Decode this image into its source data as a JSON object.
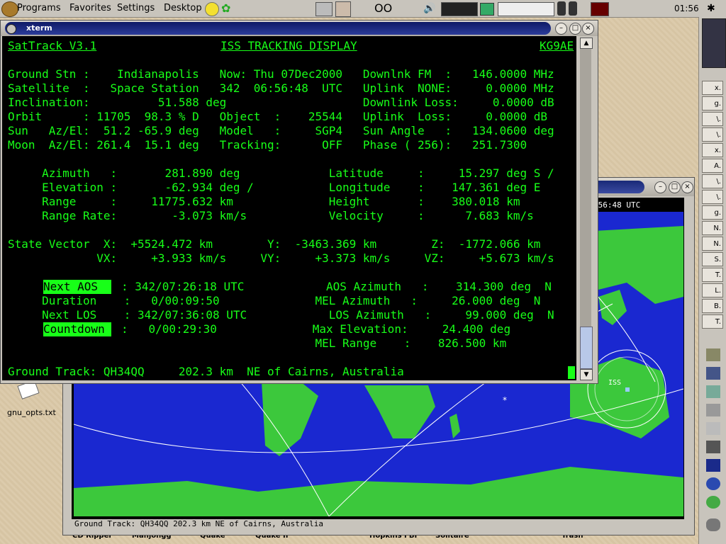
{
  "panel": {
    "programs": "Programs",
    "favorites": "Favorites",
    "settings": "Settings",
    "desktop": "Desktop",
    "clock": "01:56"
  },
  "xterm": {
    "title": "xterm",
    "header_left": "SatTrack V3.1",
    "header_center": "ISS TRACKING DISPLAY",
    "header_right": "KG9AE",
    "lines": {
      "r1": "Ground Stn :    Indianapolis   Now: Thu 07Dec2000   Downlnk FM  :   146.0000 MHz",
      "r2": "Satellite  :   Space Station   342  06:56:48  UTC   Uplink  NONE:     0.0000 MHz",
      "r3": "Inclination:          51.588 deg                    Downlink Loss:     0.0000 dB",
      "r4": "Orbit      : 11705  98.3 % D   Object  :    25544   Uplink  Loss:     0.0000 dB",
      "r5": "Sun   Az/El:  51.2 -65.9 deg   Model   :     SGP4   Sun Angle   :   134.0600 deg",
      "r6": "Moon  Az/El: 261.4  15.1 deg   Tracking:      OFF   Phase ( 256):   251.7300",
      "r7": "     Azimuth   :       281.890 deg             Latitude     :     15.297 deg S /",
      "r8": "     Elevation :       -62.934 deg /           Longitude    :    147.361 deg E",
      "r9": "     Range     :     11775.632 km              Height       :    380.018 km",
      "r10": "     Range Rate:        -3.073 km/s            Velocity     :      7.683 km/s",
      "r11": "State Vector  X:  +5524.472 km        Y:  -3463.369 km        Z:  -1772.066 km",
      "r12": "             VX:     +3.933 km/s     VY:     +3.373 km/s     VZ:     +5.673 km/s",
      "r13a": "Next AOS  ",
      "r13b": ": 342/07:26:18 UTC            AOS Azimuth   :    314.300 deg  N",
      "r14": "     Duration    :   0/00:09:50              MEL Azimuth   :     26.000 deg  N",
      "r15": "     Next LOS    : 342/07:36:08 UTC            LOS Azimuth   :     99.000 deg  N",
      "r16a": "Countdown ",
      "r16b": ":   0/00:29:30              Max Elevation:     24.400 deg",
      "r17": "                                             MEL Range    :    826.500 km",
      "r18": "Ground Track: QH34QQ     202.3 km  NE of Cairns, Australia"
    }
  },
  "map": {
    "time_readout": ":56:48 UTC",
    "sat_label": "ISS",
    "ground_track": "Ground Track: QH34QQ     202.3 km  NE of Cairns, Australia"
  },
  "desktop_icon": {
    "label": "gnu_opts.txt"
  },
  "taskbar_labels": [
    "CD Ripper",
    "Mahjongg",
    "Quake",
    "Quake II",
    "Hopkins FBI",
    "Solitaire",
    "Trash"
  ],
  "colors": {
    "terminal_bg": "#000000",
    "terminal_fg": "#18ff18",
    "ocean": "#1a28d0",
    "land": "#3cc83c"
  }
}
